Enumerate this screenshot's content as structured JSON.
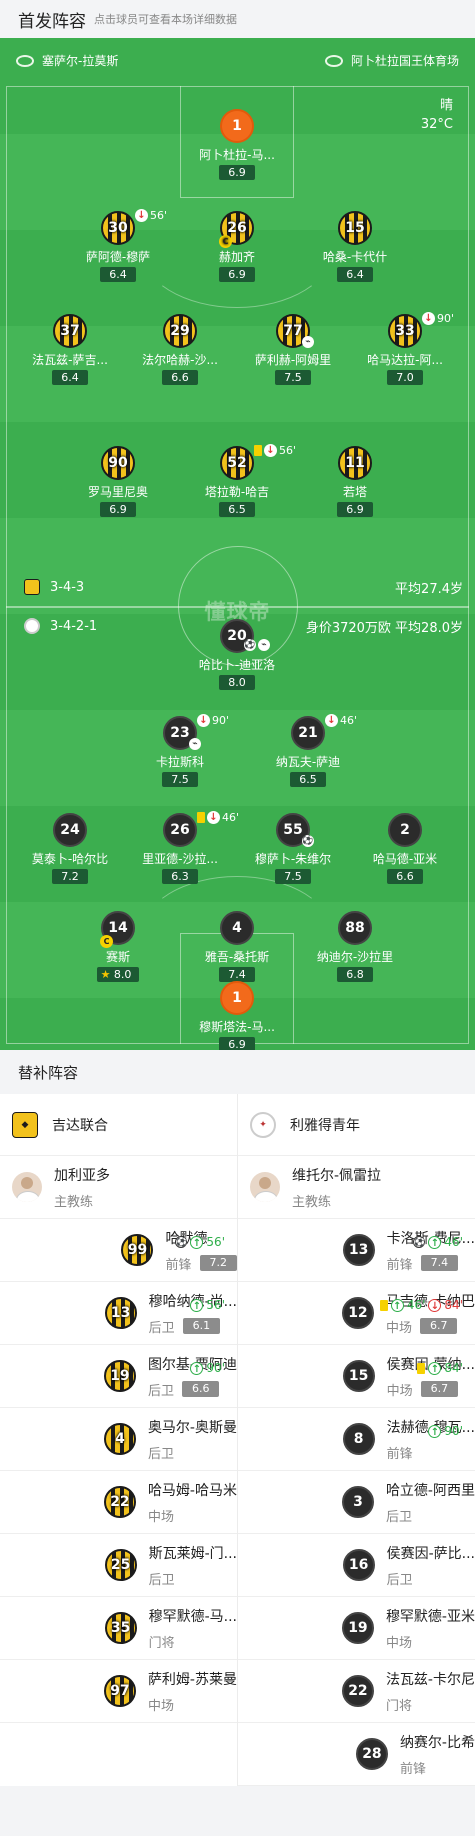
{
  "lineup_header": {
    "title": "首发阵容",
    "hint": "点击球员可查看本场详细数据"
  },
  "match": {
    "referee": "塞萨尔-拉莫斯",
    "venue": "阿卜杜拉国王体育场",
    "weather": "晴",
    "temperature": "32°C"
  },
  "home": {
    "formation": "3-4-3",
    "avg_age": "平均27.4岁",
    "players": [
      {
        "num": "1",
        "name": "阿卜杜拉-马...",
        "rating": "6.9"
      },
      {
        "num": "30",
        "name": "萨阿德-穆萨",
        "rating": "6.4",
        "sub_out": "56'"
      },
      {
        "num": "26",
        "name": "赫加齐",
        "rating": "6.9",
        "captain": "C"
      },
      {
        "num": "15",
        "name": "哈桑-卡代什",
        "rating": "6.4"
      },
      {
        "num": "37",
        "name": "法瓦兹-萨吉...",
        "rating": "6.4"
      },
      {
        "num": "29",
        "name": "法尔哈赫-沙...",
        "rating": "6.6"
      },
      {
        "num": "77",
        "name": "萨利赫-阿姆里",
        "rating": "7.5",
        "assist": "true"
      },
      {
        "num": "33",
        "name": "哈马达拉-阿...",
        "rating": "7.0",
        "sub_out": "90'"
      },
      {
        "num": "90",
        "name": "罗马里尼奥",
        "rating": "6.9"
      },
      {
        "num": "52",
        "name": "塔拉勒-哈吉",
        "rating": "6.5",
        "sub_out": "56'",
        "yellow": "true"
      },
      {
        "num": "11",
        "name": "若塔",
        "rating": "6.9"
      }
    ]
  },
  "away": {
    "formation": "3-4-2-1",
    "value_age": "身价3720万欧 平均28.0岁",
    "players": [
      {
        "num": "20",
        "name": "哈比卜-迪亚洛",
        "rating": "8.0"
      },
      {
        "num": "23",
        "name": "卡拉斯科",
        "rating": "7.5",
        "sub_out": "90'"
      },
      {
        "num": "21",
        "name": "纳瓦夫-萨迪",
        "rating": "6.5",
        "sub_out": "46'"
      },
      {
        "num": "24",
        "name": "莫泰卜-哈尔比",
        "rating": "7.2"
      },
      {
        "num": "26",
        "name": "里亚德-沙拉...",
        "rating": "6.3",
        "sub_out": "46'",
        "yellow": "true"
      },
      {
        "num": "55",
        "name": "穆萨卜-朱维尔",
        "rating": "7.5"
      },
      {
        "num": "2",
        "name": "哈马德-亚米",
        "rating": "6.6"
      },
      {
        "num": "14",
        "name": "赛斯",
        "rating": "8.0",
        "captain": "C",
        "mvp": "true"
      },
      {
        "num": "4",
        "name": "雅吾-桑托斯",
        "rating": "7.4"
      },
      {
        "num": "88",
        "name": "纳迪尔-沙拉里",
        "rating": "6.8"
      },
      {
        "num": "1",
        "name": "穆斯塔法-马...",
        "rating": "6.9"
      }
    ]
  },
  "watermark": "懂球帝",
  "subs_header": {
    "title": "替补阵容"
  },
  "subs": {
    "home": {
      "team": "吉达联合",
      "coach": {
        "name": "加利亚多",
        "role": "主教练"
      },
      "players": [
        {
          "num": "99",
          "name": "哈默德",
          "pos": "前锋",
          "rating": "7.2",
          "goal": "true",
          "in": "56'"
        },
        {
          "num": "13",
          "name": "穆哈纳德-尚...",
          "pos": "后卫",
          "rating": "6.1",
          "in": "56'"
        },
        {
          "num": "19",
          "name": "图尔基-贾阿迪",
          "pos": "后卫",
          "rating": "6.6",
          "in": "90'"
        },
        {
          "num": "4",
          "name": "奥马尔-奥斯曼",
          "pos": "后卫"
        },
        {
          "num": "22",
          "name": "哈马姆-哈马米",
          "pos": "中场"
        },
        {
          "num": "25",
          "name": "斯瓦莱姆-门...",
          "pos": "后卫"
        },
        {
          "num": "35",
          "name": "穆罕默德-马...",
          "pos": "门将"
        },
        {
          "num": "97",
          "name": "萨利姆-苏莱曼",
          "pos": "中场"
        }
      ]
    },
    "away": {
      "team": "利雅得青年",
      "coach": {
        "name": "维托尔-佩雷拉",
        "role": "主教练"
      },
      "players": [
        {
          "num": "13",
          "name": "卡洛斯-费尼...",
          "pos": "前锋",
          "rating": "7.4",
          "goal": "true",
          "in": "46'"
        },
        {
          "num": "12",
          "name": "马吉德-卡纳巴",
          "pos": "中场",
          "rating": "6.7",
          "yellow": "true",
          "in": "46'",
          "out": "84'"
        },
        {
          "num": "15",
          "name": "侯赛因-蒙纳...",
          "pos": "中场",
          "rating": "6.7",
          "yellow": "true",
          "in": "84'"
        },
        {
          "num": "8",
          "name": "法赫德-穆瓦...",
          "pos": "前锋",
          "in": "90'"
        },
        {
          "num": "3",
          "name": "哈立德-阿西里",
          "pos": "后卫"
        },
        {
          "num": "16",
          "name": "侯赛因-萨比...",
          "pos": "后卫"
        },
        {
          "num": "19",
          "name": "穆罕默德-亚米",
          "pos": "中场"
        },
        {
          "num": "22",
          "name": "法瓦兹-卡尔尼",
          "pos": "门将"
        },
        {
          "num": "28",
          "name": "纳赛尔-比希",
          "pos": "前锋"
        }
      ]
    }
  },
  "colors": {
    "pitch": "#3cae4f",
    "home_kit": "#f2c21c",
    "away_kit": "#2b2b2b",
    "keeper": "#f26a1b"
  }
}
